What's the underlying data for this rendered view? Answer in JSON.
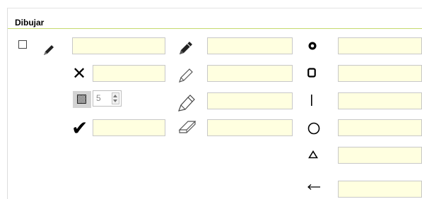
{
  "section": {
    "title": "Dibujar"
  },
  "spinner": {
    "value": "5"
  },
  "icons": {
    "checkbox": "checkbox-icon",
    "pencil_small": "pencil-icon",
    "cross": "x-mark-icon",
    "pattern": "fill-pattern-icon",
    "checkmark": "checkmark-icon",
    "pencil_solid": "pencil-solid-icon",
    "pencil_outline": "pencil-outline-icon",
    "highlighter": "highlighter-icon",
    "eraser": "eraser-icon",
    "dot_circle": "point-icon",
    "rounded_rect": "rectangle-icon",
    "line": "line-icon",
    "circle": "circle-icon",
    "triangle": "triangle-icon",
    "arrow": "arrow-left-icon"
  },
  "fields": {
    "col1": [
      "",
      "",
      ""
    ],
    "col2": [
      "",
      "",
      "",
      ""
    ],
    "col3": [
      "",
      "",
      "",
      "",
      "",
      ""
    ]
  },
  "colors": {
    "field_bg": "#ffffe0",
    "accent_line": "#c6d96e"
  }
}
